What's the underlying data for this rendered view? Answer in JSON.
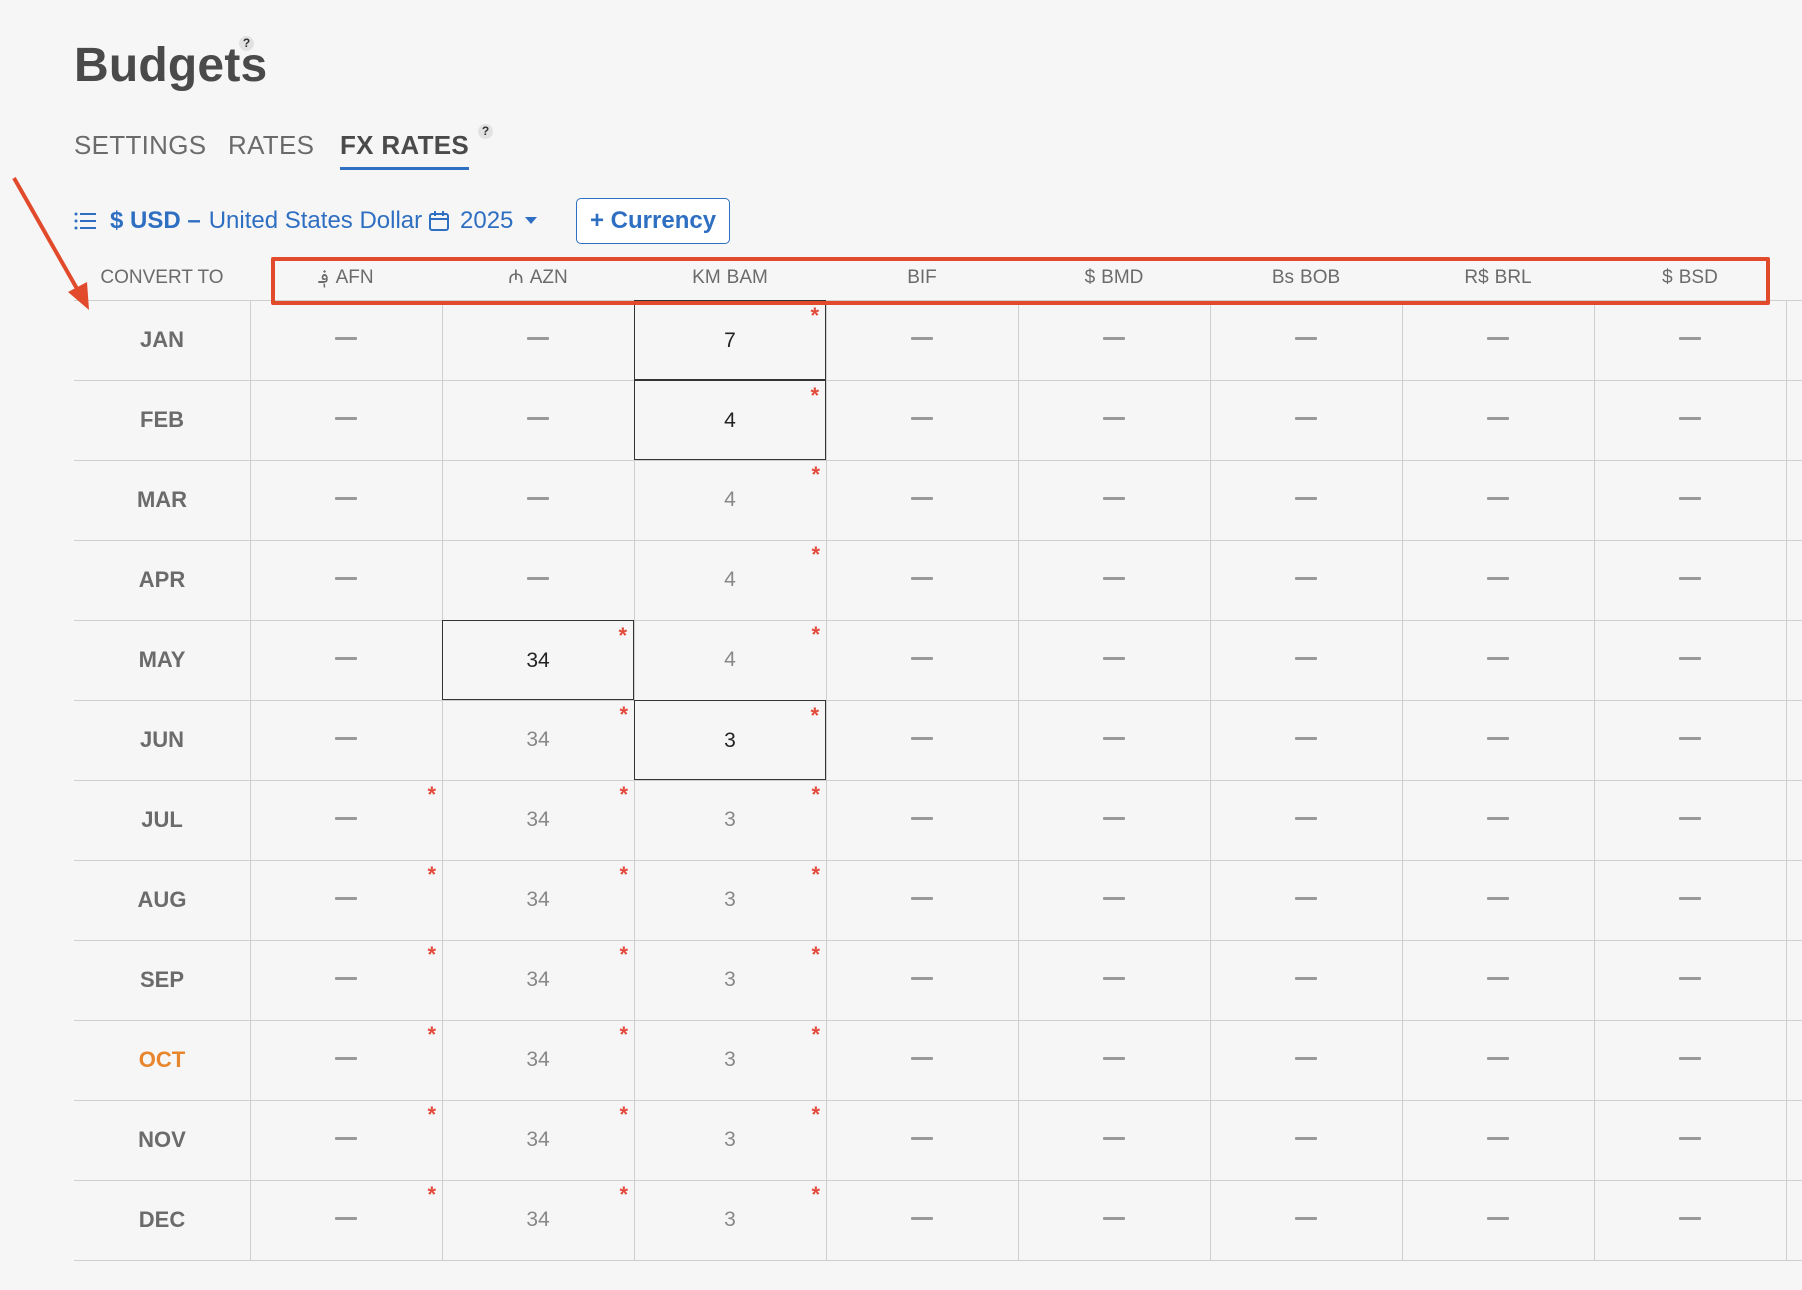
{
  "page": {
    "title": "Budgets",
    "title_help": "?"
  },
  "tabs": [
    {
      "label": "SETTINGS",
      "active": false
    },
    {
      "label": "RATES",
      "active": false
    },
    {
      "label": "FX RATES",
      "active": true,
      "help": "?"
    }
  ],
  "toolbar": {
    "list_icon": "list-icon",
    "base_currency_code": "$ USD –",
    "base_currency_name": "United States Dollar",
    "calendar_icon": "calendar-icon",
    "year": "2025",
    "add_currency_label": "+ Currency",
    "accent_color": "#2f6fc2"
  },
  "table": {
    "convert_to_label": "CONVERT TO",
    "columns": [
      {
        "symbol": "؋",
        "code": "AFN"
      },
      {
        "symbol": "₼",
        "code": "AZN"
      },
      {
        "symbol": "KM",
        "code": "BAM"
      },
      {
        "symbol": "",
        "code": "BIF"
      },
      {
        "symbol": "$",
        "code": "BMD"
      },
      {
        "symbol": "Bs",
        "code": "BOB"
      },
      {
        "symbol": "R$",
        "code": "BRL"
      },
      {
        "symbol": "$",
        "code": "BSD"
      }
    ],
    "rows": [
      {
        "month": "JAN",
        "current": false,
        "cells": [
          {
            "v": ""
          },
          {
            "v": ""
          },
          {
            "v": "7",
            "set": true,
            "star": true
          },
          {
            "v": ""
          },
          {
            "v": ""
          },
          {
            "v": ""
          },
          {
            "v": ""
          },
          {
            "v": ""
          }
        ]
      },
      {
        "month": "FEB",
        "current": false,
        "cells": [
          {
            "v": ""
          },
          {
            "v": ""
          },
          {
            "v": "4",
            "set": true,
            "star": true
          },
          {
            "v": ""
          },
          {
            "v": ""
          },
          {
            "v": ""
          },
          {
            "v": ""
          },
          {
            "v": ""
          }
        ]
      },
      {
        "month": "MAR",
        "current": false,
        "cells": [
          {
            "v": ""
          },
          {
            "v": ""
          },
          {
            "v": "4",
            "star": true
          },
          {
            "v": ""
          },
          {
            "v": ""
          },
          {
            "v": ""
          },
          {
            "v": ""
          },
          {
            "v": ""
          }
        ]
      },
      {
        "month": "APR",
        "current": false,
        "cells": [
          {
            "v": ""
          },
          {
            "v": ""
          },
          {
            "v": "4",
            "star": true
          },
          {
            "v": ""
          },
          {
            "v": ""
          },
          {
            "v": ""
          },
          {
            "v": ""
          },
          {
            "v": ""
          }
        ]
      },
      {
        "month": "MAY",
        "current": false,
        "cells": [
          {
            "v": ""
          },
          {
            "v": "34",
            "set": true,
            "star": true
          },
          {
            "v": "4",
            "star": true
          },
          {
            "v": ""
          },
          {
            "v": ""
          },
          {
            "v": ""
          },
          {
            "v": ""
          },
          {
            "v": ""
          }
        ]
      },
      {
        "month": "JUN",
        "current": false,
        "cells": [
          {
            "v": ""
          },
          {
            "v": "34",
            "star": true
          },
          {
            "v": "3",
            "set": true,
            "star": true
          },
          {
            "v": ""
          },
          {
            "v": ""
          },
          {
            "v": ""
          },
          {
            "v": ""
          },
          {
            "v": ""
          }
        ]
      },
      {
        "month": "JUL",
        "current": false,
        "cells": [
          {
            "v": "",
            "star": true
          },
          {
            "v": "34",
            "star": true
          },
          {
            "v": "3",
            "star": true
          },
          {
            "v": ""
          },
          {
            "v": ""
          },
          {
            "v": ""
          },
          {
            "v": ""
          },
          {
            "v": ""
          }
        ]
      },
      {
        "month": "AUG",
        "current": false,
        "cells": [
          {
            "v": "",
            "star": true
          },
          {
            "v": "34",
            "star": true
          },
          {
            "v": "3",
            "star": true
          },
          {
            "v": ""
          },
          {
            "v": ""
          },
          {
            "v": ""
          },
          {
            "v": ""
          },
          {
            "v": ""
          }
        ]
      },
      {
        "month": "SEP",
        "current": false,
        "cells": [
          {
            "v": "",
            "star": true
          },
          {
            "v": "34",
            "star": true
          },
          {
            "v": "3",
            "star": true
          },
          {
            "v": ""
          },
          {
            "v": ""
          },
          {
            "v": ""
          },
          {
            "v": ""
          },
          {
            "v": ""
          }
        ]
      },
      {
        "month": "OCT",
        "current": true,
        "cells": [
          {
            "v": "",
            "star": true
          },
          {
            "v": "34",
            "star": true
          },
          {
            "v": "3",
            "star": true
          },
          {
            "v": ""
          },
          {
            "v": ""
          },
          {
            "v": ""
          },
          {
            "v": ""
          },
          {
            "v": ""
          }
        ]
      },
      {
        "month": "NOV",
        "current": false,
        "cells": [
          {
            "v": "",
            "star": true
          },
          {
            "v": "34",
            "star": true
          },
          {
            "v": "3",
            "star": true
          },
          {
            "v": ""
          },
          {
            "v": ""
          },
          {
            "v": ""
          },
          {
            "v": ""
          },
          {
            "v": ""
          }
        ]
      },
      {
        "month": "DEC",
        "current": false,
        "cells": [
          {
            "v": "",
            "star": true
          },
          {
            "v": "34",
            "star": true
          },
          {
            "v": "3",
            "star": true
          },
          {
            "v": ""
          },
          {
            "v": ""
          },
          {
            "v": ""
          },
          {
            "v": ""
          },
          {
            "v": ""
          }
        ]
      }
    ],
    "required_marker": "*",
    "current_month_color": "#e8862e"
  },
  "annotation": {
    "color": "#e24a2c"
  }
}
